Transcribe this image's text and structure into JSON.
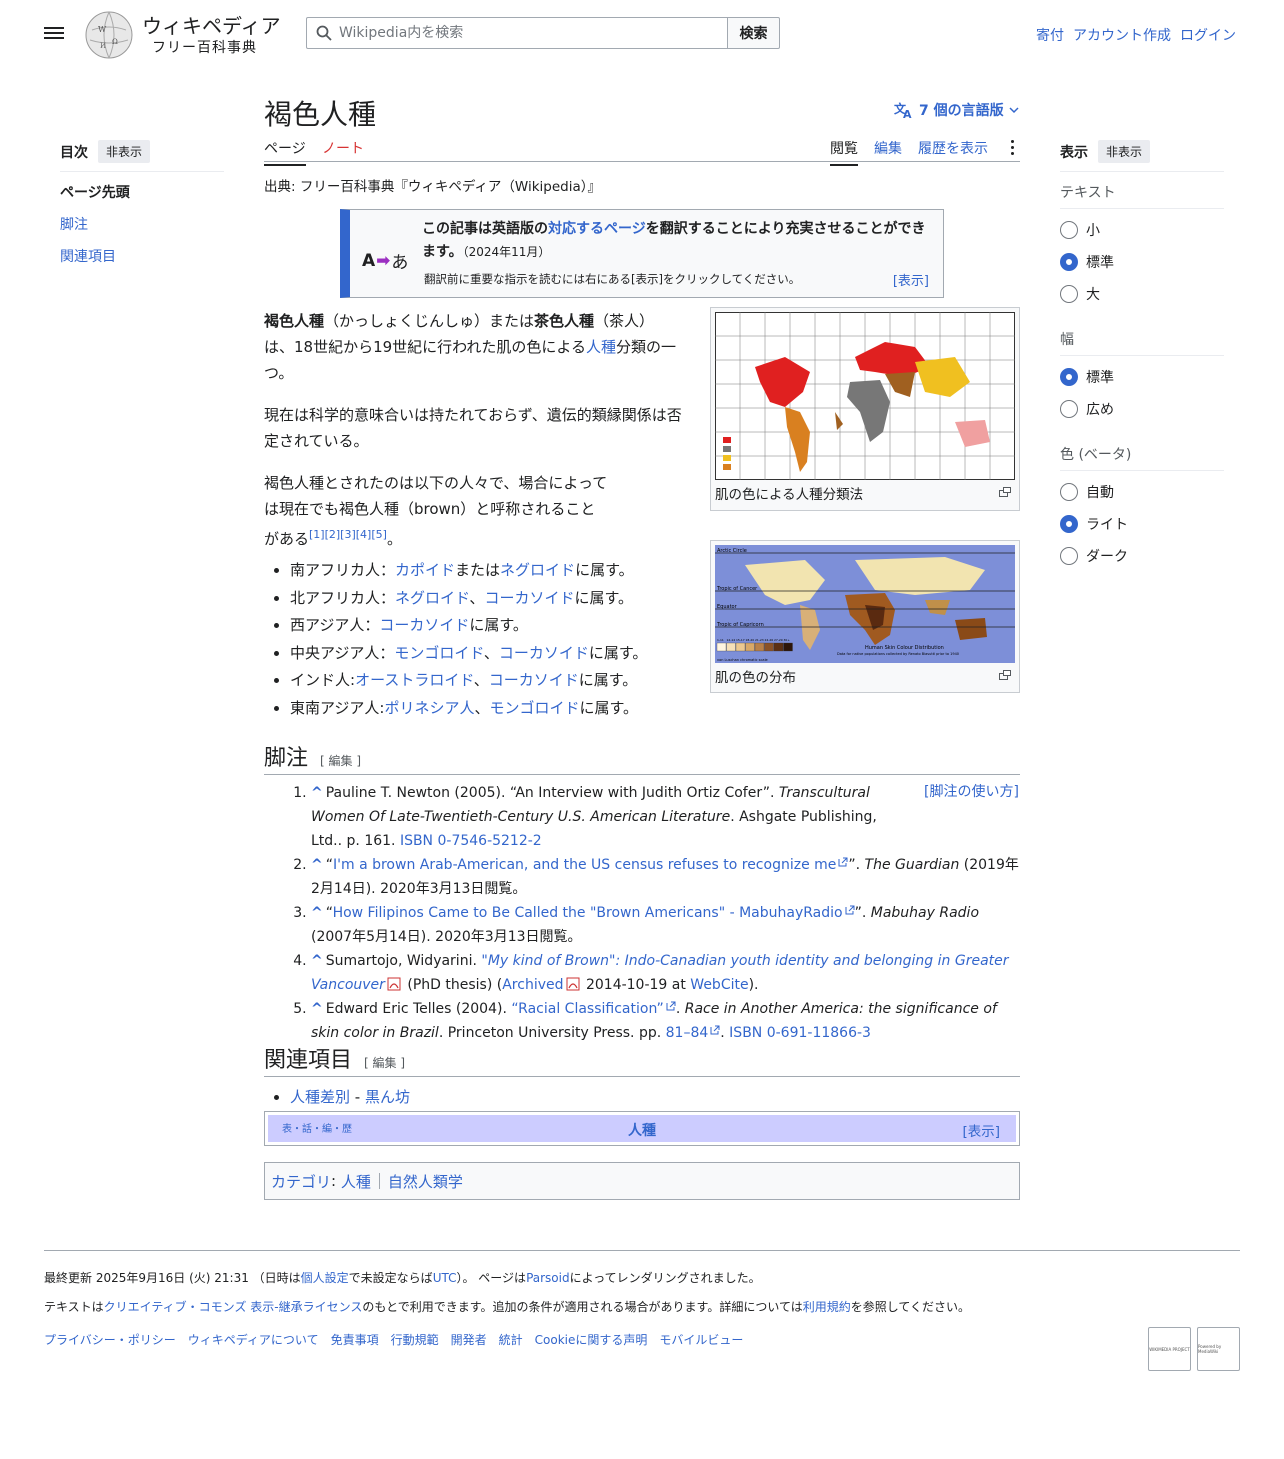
{
  "header": {
    "logo_title": "ウィキペディア",
    "logo_sub": "フリー百科事典",
    "search_placeholder": "Wikipedia内を検索",
    "search_button": "検索",
    "user_links": [
      "寄付",
      "アカウント作成",
      "ログイン"
    ]
  },
  "toc": {
    "title": "目次",
    "hide": "非表示",
    "items": [
      "ページ先頭",
      "脚注",
      "関連項目"
    ]
  },
  "article": {
    "title": "褐色人種",
    "languages": "7 個の言語版",
    "tabs": {
      "page": "ページ",
      "talk": "ノート",
      "read": "閲覧",
      "edit": "編集",
      "history": "履歴を表示"
    },
    "source": "出典: フリー百科事典『ウィキペディア（Wikipedia）』",
    "ambox": {
      "icon_a": "A",
      "icon_b": "あ",
      "t1": "この記事は",
      "t2": "英語版",
      "t3": "の",
      "t4": "対応するページ",
      "t5": "を翻訳することにより充実させることができます。",
      "date": "（2024年11月）",
      "note": "翻訳前に重要な指示を読むには右にある[表示]をクリックしてください。",
      "show": "[表示]"
    },
    "p1": {
      "b1": "褐色人種",
      "r1": "（かっしょくじんしゅ）または",
      "b2": "茶色人種",
      "r2": "（茶人）は、18世紀から19世紀に行われた肌の色による",
      "link": "人種",
      "r3": "分類の一つ。"
    },
    "p2": "現在は科学的意味合いは持たれておらず、遺伝的類縁関係は否定されている。",
    "p3": {
      "text": "褐色人種とされたのは以下の人々で、場合によっては現在でも褐色人種（brown）と呼称されることがある",
      "refs": "[1][2][3][4][5]",
      "end": "。"
    },
    "bullets": [
      {
        "a": "南アフリカ人：",
        "l1": "カポイド",
        "m": "または",
        "l2": "ネグロイド",
        "e": "に属す。"
      },
      {
        "a": "北アフリカ人：",
        "l1": "ネグロイド",
        "m": "、",
        "l2": "コーカソイド",
        "e": "に属す。"
      },
      {
        "a": "西アジア人：",
        "l1": "コーカソイド",
        "m": "",
        "l2": "",
        "e": "に属す。"
      },
      {
        "a": "中央アジア人：",
        "l1": "モンゴロイド",
        "m": "、",
        "l2": "コーカソイド",
        "e": "に属す。"
      },
      {
        "a": "インド人:",
        "l1": "オーストラロイド",
        "m": "、",
        "l2": "コーカソイド",
        "e": "に属す。"
      },
      {
        "a": "東南アジア人:",
        "l1": "ポリネシア人",
        "m": "、",
        "l2": "モンゴロイド",
        "e": "に属す。"
      }
    ],
    "thumb1_caption": "肌の色による人種分類法",
    "thumb2_caption": "肌の色の分布",
    "map2_labels": {
      "arctic": "Arctic Circle",
      "cancer": "Tropic of Cancer",
      "equator": "Equator",
      "capricorn": "Tropic of Capricorn",
      "title": "Human Skin Colour Distribution",
      "subtitle": "Data for native populations collected by Renato Biasutti prior to 1940",
      "scale_note": "von Luschan chromatic scale",
      "scale": [
        "1-11",
        "12-14",
        "15-17",
        "18-20",
        "21-23",
        "24-26",
        "27-29",
        "30+"
      ]
    },
    "footnotes_heading": "脚注",
    "edit_label": "[ 編集 ]",
    "ref_usage": "[脚注の使い方]",
    "refs": [
      {
        "t1": "Pauline T. Newton (2005). “An Interview with Judith Ortiz Cofer”. ",
        "i1": "Transcultural Women Of Late-Twentieth-Century U.S. American Literature",
        "t2": ". Ashgate Publishing, Ltd.. p. 161. ",
        "l1": "ISBN 0-7546-5212-2"
      },
      {
        "t1": "“",
        "l1": "I'm a brown Arab-American, and the US census refuses to recognize me",
        "t2": "”. ",
        "i1": "The Guardian",
        "t3": " (2019年2月14日). 2020年3月13日閲覧。"
      },
      {
        "t1": "“",
        "l1": "How Filipinos Came to Be Called the \"Brown Americans\" - MabuhayRadio",
        "t2": "”. ",
        "i1": "Mabuhay Radio",
        "t3": " (2007年5月14日). 2020年3月13日閲覧。"
      },
      {
        "t1": "Sumartojo, Widyarini. ",
        "l1": "\"My kind of Brown\": Indo-Canadian youth identity and belonging in Greater Vancouver",
        "t2": " (PhD thesis) (",
        "l2": "Archived",
        "t3": " 2014-10-19 at ",
        "l3": "WebCite",
        "t4": ")."
      },
      {
        "t1": "Edward Eric Telles (2004). ",
        "l1": "“Racial Classification”",
        "t2": ". ",
        "i1": "Race in Another America: the significance of skin color in Brazil",
        "t3": ". Princeton University Press. pp. ",
        "l2": "81–84",
        "t4": ". ",
        "l3": "ISBN 0-691-11866-3"
      }
    ],
    "related_heading": "関連項目",
    "related": {
      "l1": "人種差別",
      "sep": " - ",
      "l2": "黒ん坊"
    },
    "navbox": {
      "vde": "表・話・編・歴",
      "title": "人種",
      "show": "[表示]"
    },
    "categories": {
      "label": "カテゴリ",
      "items": [
        "人種",
        "自然人類学"
      ]
    }
  },
  "appearance": {
    "title": "表示",
    "hide": "非表示",
    "text_label": "テキスト",
    "text_options": [
      "小",
      "標準",
      "大"
    ],
    "width_label": "幅",
    "width_options": [
      "標準",
      "広め"
    ],
    "color_label": "色 (ベータ)",
    "color_options": [
      "自動",
      "ライト",
      "ダーク"
    ],
    "accent": "#3366cc"
  },
  "footer": {
    "last_mod": {
      "t1": "最終更新 2025年9月16日 (火) 21:31 （日時は",
      "l1": "個人設定",
      "t2": "で未設定ならば",
      "l2": "UTC",
      "t3": "）。 ページは",
      "l3": "Parsoid",
      "t4": "によってレンダリングされました。"
    },
    "license": {
      "t1": "テキストは",
      "l1": "クリエイティブ・コモンズ 表示-継承ライセンス",
      "t2": "のもとで利用できます。追加の条件が適用される場合があります。詳細については",
      "l2": "利用規約",
      "t3": "を参照してください。"
    },
    "links": [
      "プライバシー・ポリシー",
      "ウィキペディアについて",
      "免責事項",
      "行動規範",
      "開発者",
      "統計",
      "Cookieに関する声明",
      "モバイルビュー"
    ],
    "badge1": "WIKIMEDIA PROJECT",
    "badge2": "Powered by MediaWiki"
  }
}
